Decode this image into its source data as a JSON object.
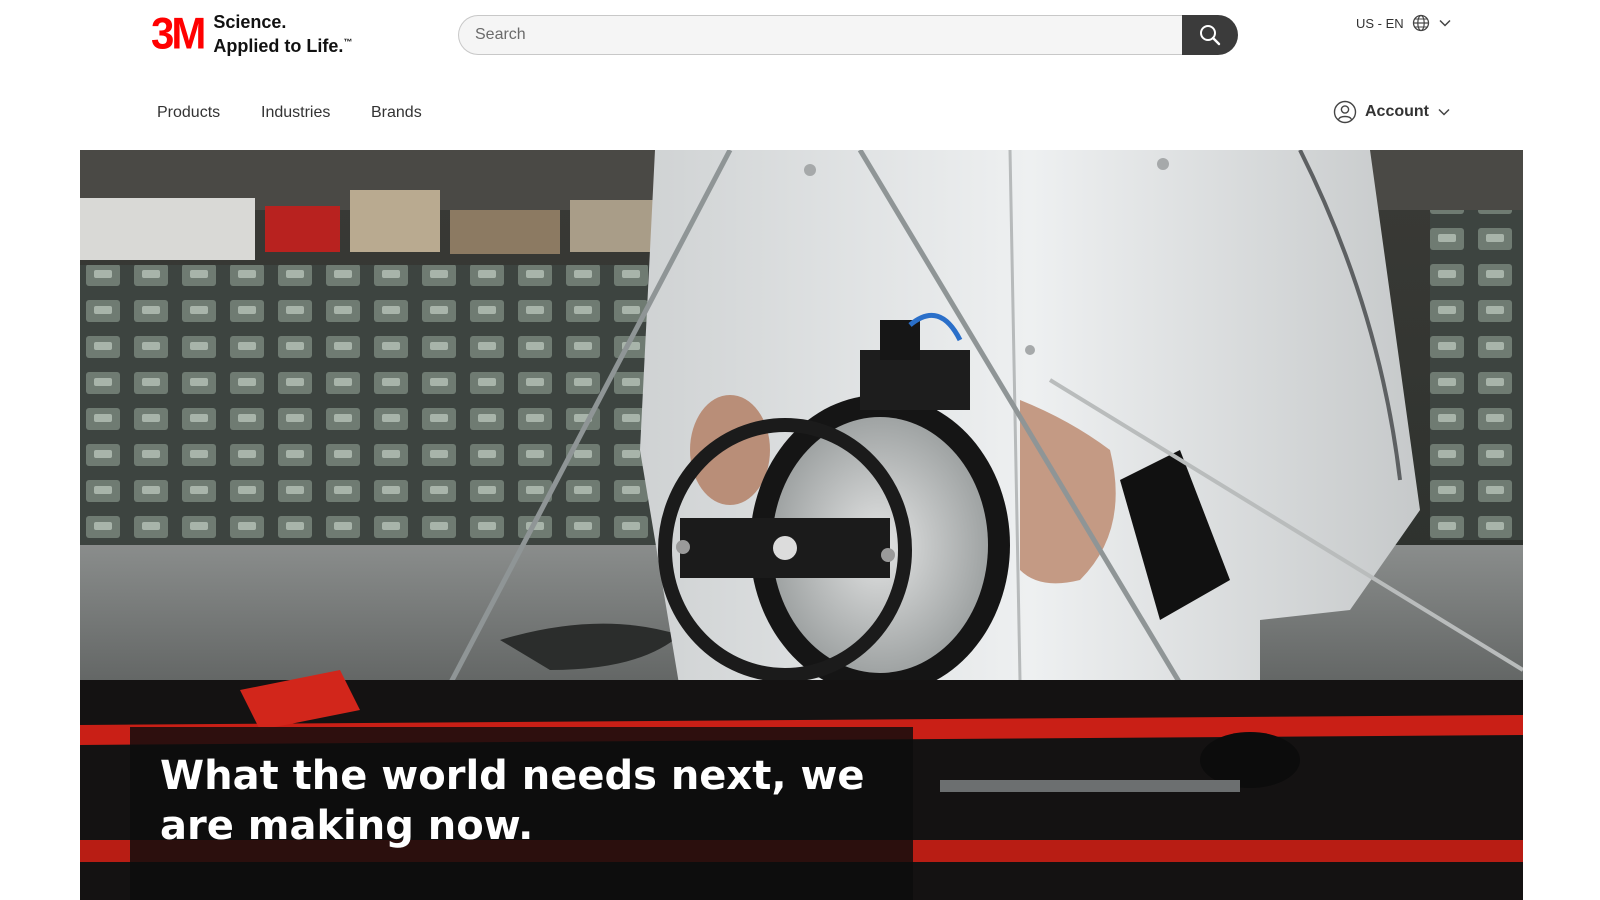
{
  "brand": {
    "logo_mark": "3M",
    "tagline_line1": "Science.",
    "tagline_line2": "Applied to Life.",
    "trademark": "™",
    "logo_color": "#ff0000"
  },
  "search": {
    "placeholder": "Search",
    "value": "",
    "button_icon": "search-icon"
  },
  "locale": {
    "label": "US - EN",
    "icon": "globe-icon"
  },
  "nav": {
    "items": [
      {
        "label": "Products"
      },
      {
        "label": "Industries"
      },
      {
        "label": "Brands"
      }
    ]
  },
  "account": {
    "label": "Account",
    "icon": "user-icon"
  },
  "hero": {
    "headline": "What the world needs next, we are making now."
  },
  "colors": {
    "search_button": "#3b3b3b",
    "caption_bg": "#0c0c0c",
    "accent_red": "#ff0000"
  }
}
